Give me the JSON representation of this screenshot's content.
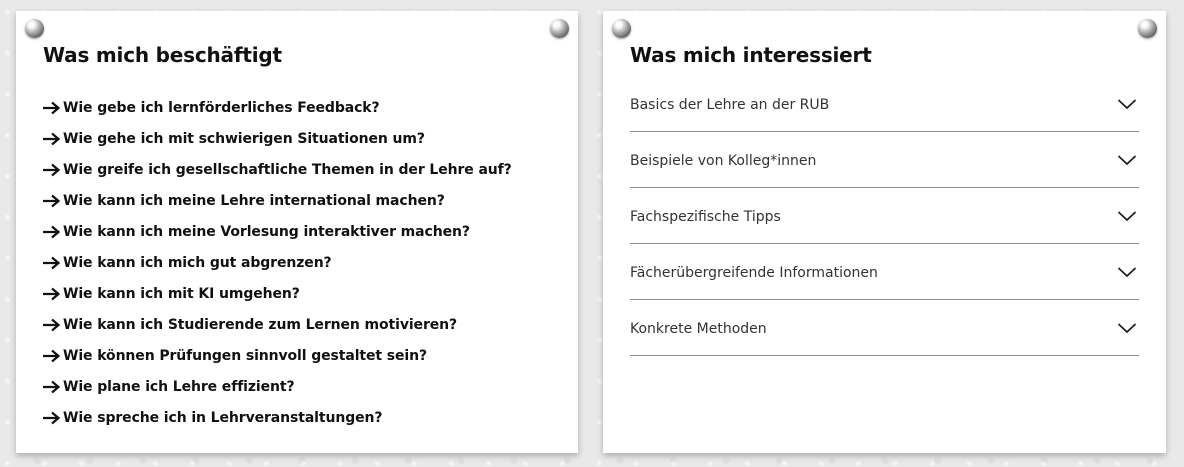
{
  "left_card": {
    "title": "Was mich beschäftigt",
    "links": [
      {
        "label": "Wie gebe ich lernförderliches Feedback?"
      },
      {
        "label": "Wie gehe ich mit schwierigen Situationen um?"
      },
      {
        "label": "Wie greife ich gesellschaftliche Themen in der Lehre auf?"
      },
      {
        "label": "Wie kann ich meine Lehre international machen?"
      },
      {
        "label": "Wie kann ich meine Vorlesung interaktiver machen?"
      },
      {
        "label": "Wie kann ich mich gut abgrenzen?"
      },
      {
        "label": "Wie kann ich mit KI umgehen?"
      },
      {
        "label": "Wie kann ich Studierende zum Lernen motivieren?"
      },
      {
        "label": "Wie können Prüfungen sinnvoll gestaltet sein?"
      },
      {
        "label": "Wie plane ich Lehre effizient?"
      },
      {
        "label": "Wie spreche ich in Lehrveranstaltungen?"
      }
    ],
    "link_icon": "arrow-right-icon"
  },
  "right_card": {
    "title": "Was mich interessiert",
    "accordion": [
      {
        "label": "Basics der Lehre an der RUB"
      },
      {
        "label": "Beispiele von Kolleg*innen"
      },
      {
        "label": "Fachspezifische Tipps"
      },
      {
        "label": "Fächerübergreifende Informationen"
      },
      {
        "label": "Konkrete Methoden"
      }
    ],
    "accordion_icon": "chevron-down-icon"
  },
  "colors": {
    "accent_line": "#8ea22a",
    "text": "#111111",
    "card": "#ffffff"
  }
}
